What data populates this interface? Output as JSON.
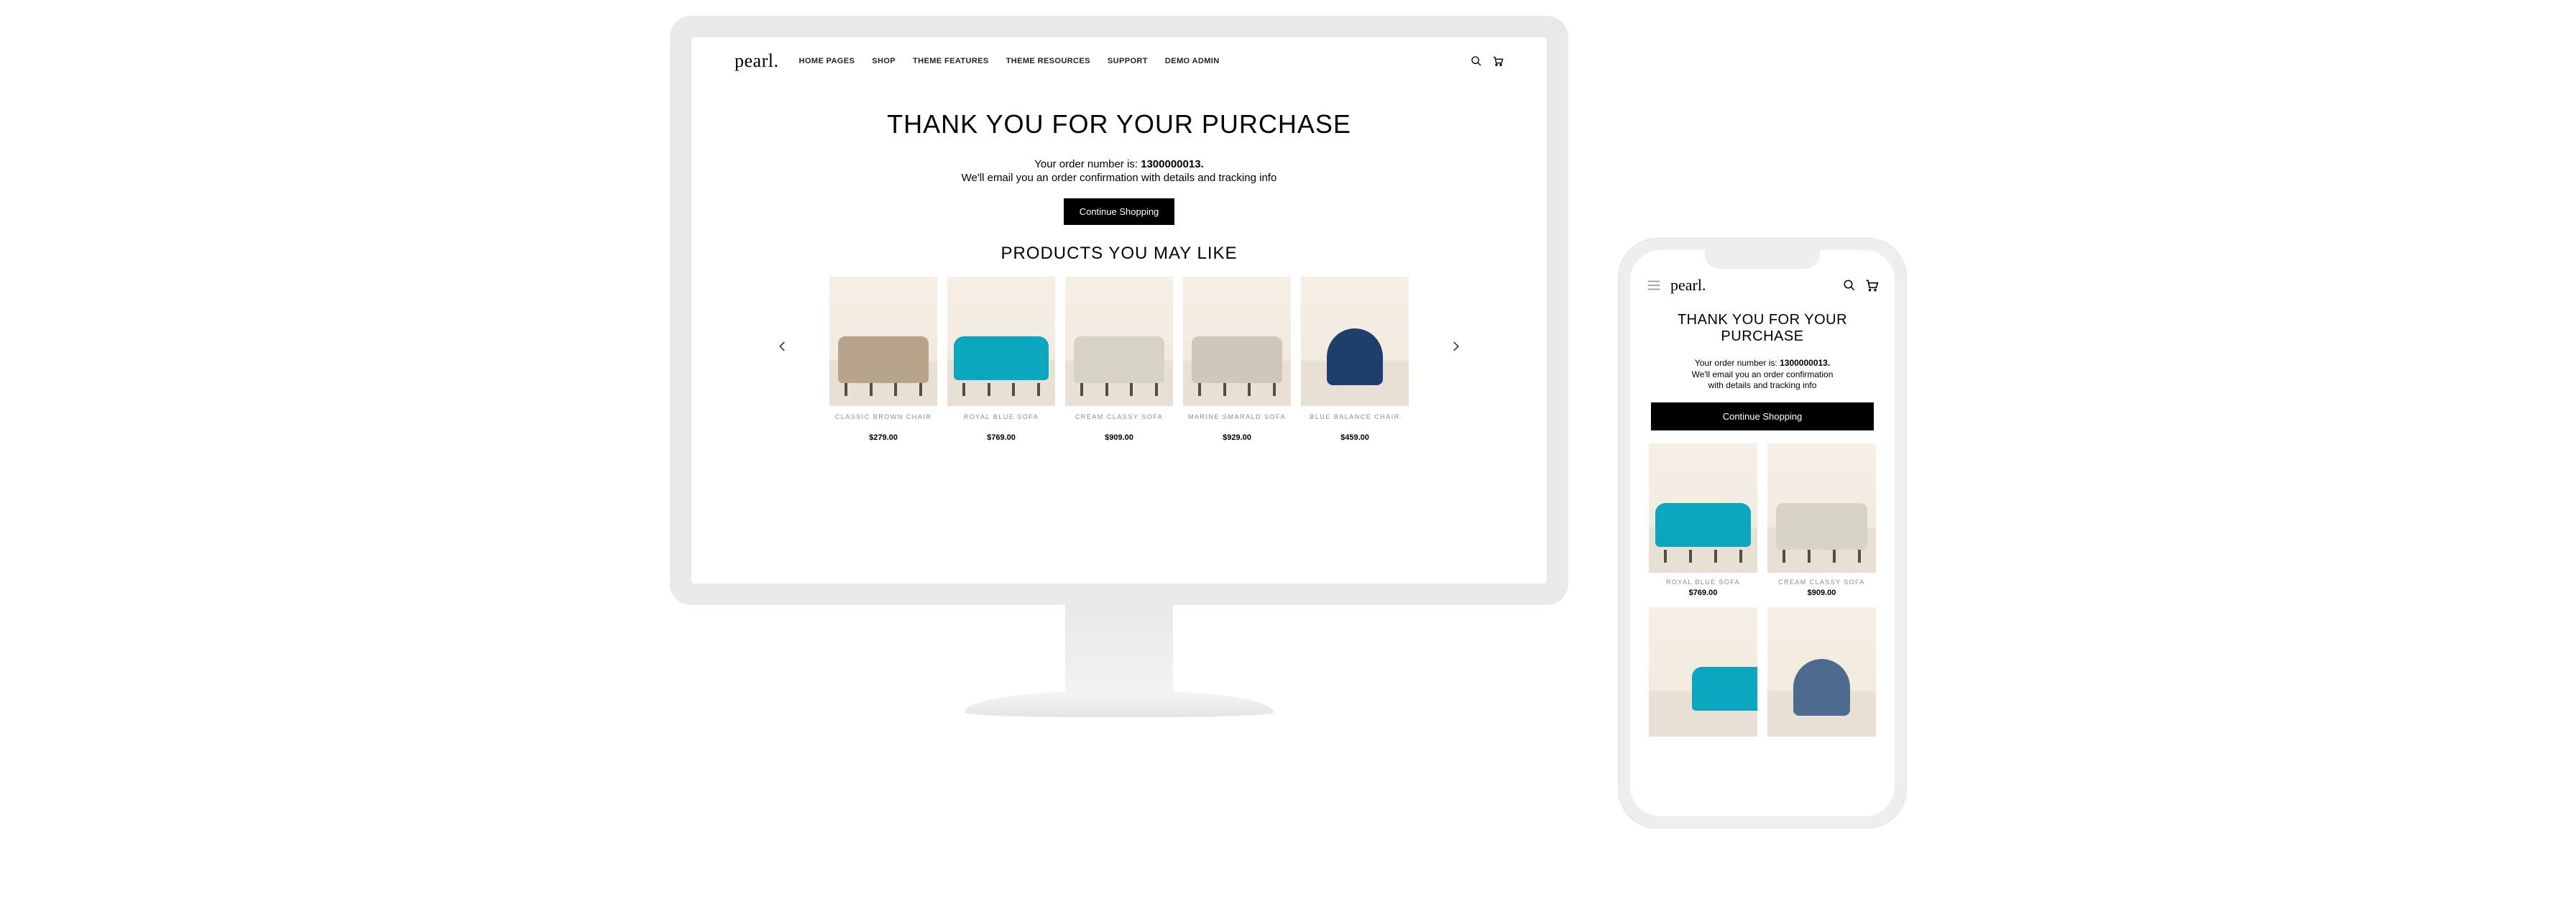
{
  "desktop": {
    "logo": "pearl.",
    "nav": [
      "HOME PAGES",
      "SHOP",
      "THEME FEATURES",
      "THEME RESOURCES",
      "SUPPORT",
      "DEMO ADMIN"
    ],
    "title": "THANK YOU FOR YOUR PURCHASE",
    "order_prefix": "Your order number is: ",
    "order_number": "1300000013.",
    "subline": "We'll email you an order confirmation with details and tracking info",
    "button": "Continue Shopping",
    "may_like": "PRODUCTS YOU MAY LIKE",
    "products": [
      {
        "name": "CLASSIC BROWN CHAIR",
        "price": "$279.00",
        "style": "brown"
      },
      {
        "name": "ROYAL BLUE SOFA",
        "price": "$769.00",
        "style": "blue"
      },
      {
        "name": "CREAM CLASSY SOFA",
        "price": "$909.00",
        "style": "cream"
      },
      {
        "name": "MARINE SMARALD SOFA",
        "price": "$929.00",
        "style": "marine"
      },
      {
        "name": "BLUE BALANCE CHAIR",
        "price": "$459.00",
        "style": "chair"
      }
    ]
  },
  "mobile": {
    "logo": "pearl.",
    "title_line1": "THANK YOU FOR YOUR",
    "title_line2": "PURCHASE",
    "order_prefix": "Your order number is: ",
    "order_number": "1300000013.",
    "subline1": "We'll email you an order confirmation",
    "subline2": "with details and tracking info",
    "button": "Continue Shopping",
    "products": [
      {
        "name": "ROYAL BLUE SOFA",
        "price": "$769.00",
        "style": "blue"
      },
      {
        "name": "CREAM CLASSY SOFA",
        "price": "$909.00",
        "style": "cream"
      },
      {
        "name": "",
        "price": "",
        "style": "blue"
      },
      {
        "name": "",
        "price": "",
        "style": "chair"
      }
    ]
  }
}
